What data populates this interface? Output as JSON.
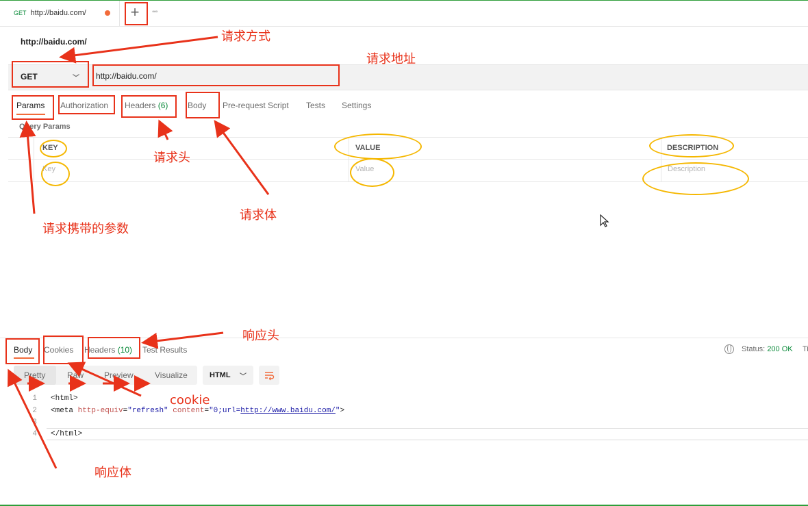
{
  "tabbar": {
    "tab_method": "GET",
    "tab_url": "http://baidu.com/",
    "new_tab": "+",
    "more": "◦◦◦"
  },
  "request": {
    "title": "http://baidu.com/",
    "method": "GET",
    "url": "http://baidu.com/",
    "tabs": [
      {
        "label": "Params"
      },
      {
        "label": "Authorization"
      },
      {
        "label": "Headers",
        "count": "(6)"
      },
      {
        "label": "Body"
      },
      {
        "label": "Pre-request Script"
      },
      {
        "label": "Tests"
      },
      {
        "label": "Settings"
      }
    ],
    "section_label": "Query Params",
    "table": {
      "headers": [
        "KEY",
        "VALUE",
        "DESCRIPTION"
      ],
      "placeholders": [
        "Key",
        "Value",
        "Description"
      ]
    }
  },
  "response": {
    "tabs": [
      {
        "label": "Body"
      },
      {
        "label": "Cookies"
      },
      {
        "label": "Headers",
        "count": "(10)"
      },
      {
        "label": "Test Results"
      }
    ],
    "status_label": "Status:",
    "status_value": "200 OK",
    "time_label": "Ti",
    "view_modes": [
      "Pretty",
      "Raw",
      "Preview",
      "Visualize"
    ],
    "language": "HTML",
    "code_lines": [
      {
        "n": "1",
        "text": "<html>"
      },
      {
        "n": "2",
        "text": "<meta http-equiv=\"refresh\" content=\"0;url=http://www.baidu.com/\">"
      },
      {
        "n": "3",
        "text": ""
      },
      {
        "n": "4",
        "text": "</html>"
      }
    ],
    "code_parts": {
      "meta_open": "<meta ",
      "attr1": "http-equiv",
      "eq1": "=",
      "val1": "\"refresh\"",
      "attr2": " content",
      "eq2": "=",
      "val2_a": "\"0;url=",
      "val2_link": "http://www.baidu.com/",
      "val2_b": "\"",
      "close": ">"
    }
  },
  "annotations": {
    "method": "请求方式",
    "address": "请求地址",
    "headers": "请求头",
    "params": "请求携带的参数",
    "body": "请求体",
    "resp_headers": "响应头",
    "cookie": "cookie",
    "resp_body": "响应体"
  },
  "colors": {
    "annotation": "#e8321a",
    "highlight": "#f5b700",
    "accent": "#f26b3a",
    "success": "#0a8a3a"
  }
}
